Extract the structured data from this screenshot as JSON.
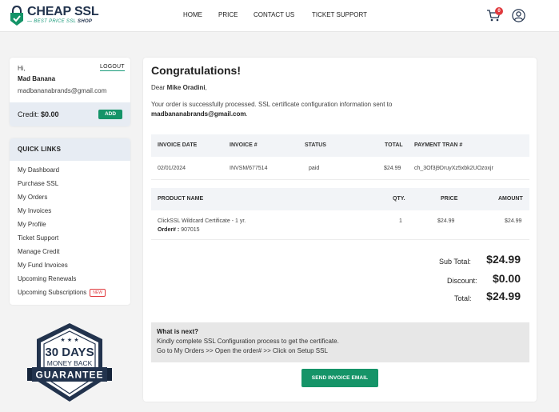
{
  "brand": {
    "name": "CHEAP SSL",
    "tagline_prefix": "BEST PRICE SSL",
    "tagline_suffix": "SHOP",
    "accent_color": "#159468",
    "dark_color": "#22334d"
  },
  "nav": {
    "items": [
      "HOME",
      "PRICE",
      "CONTACT US",
      "TICKET SUPPORT"
    ],
    "cart_count": "0",
    "cart_icon": "cart-icon",
    "user_icon": "user-circle-icon"
  },
  "profile": {
    "greeting": "Hi,",
    "logout_label": "LOGOUT",
    "name": "Mad Banana",
    "email": "madbananabrands@gmail.com",
    "credit_label": "Credit:",
    "credit_value": "$0.00",
    "add_label": "ADD"
  },
  "quick_links": {
    "title": "QUICK LINKS",
    "items": [
      {
        "label": "My Dashboard"
      },
      {
        "label": "Purchase SSL"
      },
      {
        "label": "My Orders"
      },
      {
        "label": "My Invoices"
      },
      {
        "label": "My Profile"
      },
      {
        "label": "Ticket Support"
      },
      {
        "label": "Manage Credit"
      },
      {
        "label": "My Fund Invoices"
      },
      {
        "label": "Upcoming Renewals"
      },
      {
        "label": "Upcoming Subscriptions",
        "badge": "NEW"
      }
    ]
  },
  "guarantee": {
    "days": "30 DAYS",
    "line": "MONEY BACK",
    "ribbon": "GUARANTEE"
  },
  "order": {
    "title": "Congratulations!",
    "dear_prefix": "Dear",
    "customer": "Mike Oradini",
    "dear_suffix": ",",
    "message": "Your order is successfully processed. SSL certificate configuration information sent to",
    "message_email": "madbananabrands@gmail.com",
    "message_end": ".",
    "invoice_table": {
      "headers": [
        "INVOICE DATE",
        "INVOICE #",
        "STATUS",
        "TOTAL",
        "PAYMENT TRAN #"
      ],
      "row": [
        "02/01/2024",
        "INVSM/677514",
        "paid",
        "$24.99",
        "ch_3Of3j9DruyXz5xbk2UOzoxjr"
      ]
    },
    "product_table": {
      "headers": [
        "PRODUCT NAME",
        "QTY.",
        "PRICE",
        "AMOUNT"
      ],
      "product": "ClickSSL Wildcard Certificate - 1 yr.",
      "order_label": "Order# :",
      "order_no": "907015",
      "qty": "1",
      "price": "$24.99",
      "amount": "$24.99"
    },
    "totals": {
      "subtotal_label": "Sub Total:",
      "subtotal": "$24.99",
      "discount_label": "Discount:",
      "discount": "$0.00",
      "total_label": "Total:",
      "total": "$24.99"
    },
    "next": {
      "title": "What is next?",
      "line1": "Kindly complete SSL Configuration process to get the certificate.",
      "line2": "Go to My Orders >> Open the order# >> Click on Setup SSL"
    },
    "send_label": "SEND INVOICE EMAIL"
  }
}
